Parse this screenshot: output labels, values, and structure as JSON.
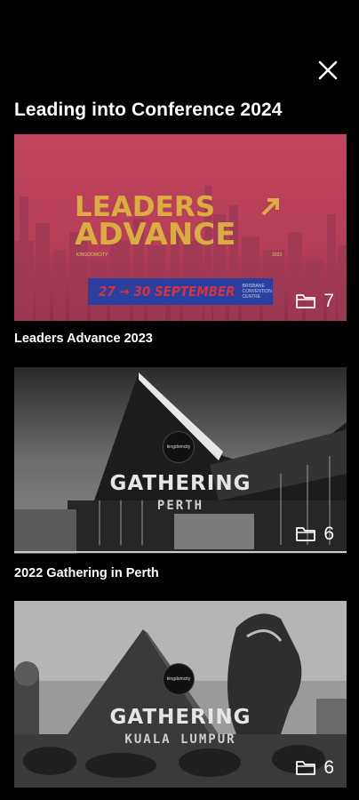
{
  "header": {
    "title": "Leading into Conference 2024"
  },
  "icons": {
    "close": "close-icon",
    "folder": "folder-icon"
  },
  "cards": [
    {
      "label": "Leaders Advance 2023",
      "count": "7",
      "thumb": {
        "line1": "LEADERS",
        "line2": "ADVANCE",
        "date": "27 → 30 SEPTEMBER",
        "venue": "BRISBANE CONVENTION CENTRE"
      }
    },
    {
      "label": "2022 Gathering in Perth",
      "count": "6",
      "thumb": {
        "badge": "kingdomcity",
        "name": "GATHERING",
        "city": "PERTH"
      }
    },
    {
      "label": "",
      "count": "6",
      "thumb": {
        "badge": "kingdomcity",
        "name": "GATHERING",
        "city": "KUALA LUMPUR"
      }
    }
  ],
  "colors": {
    "background": "#000000",
    "card1_bg": "#c2445e",
    "card1_gold": "#d9ad3f",
    "card1_blue": "#2a3f9e"
  }
}
